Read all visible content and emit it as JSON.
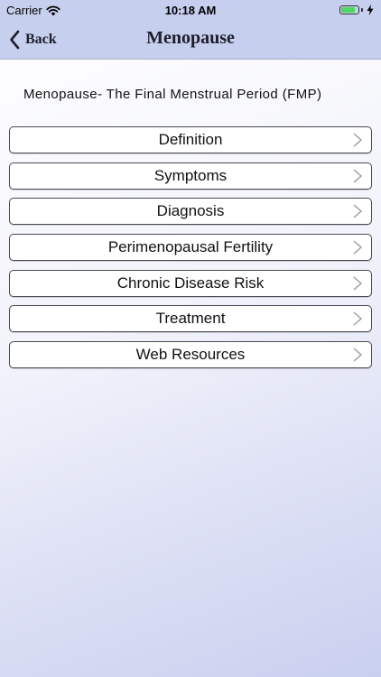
{
  "status_bar": {
    "carrier": "Carrier",
    "time": "10:18 AM",
    "battery_level": 0.85,
    "icons": [
      "wifi-icon",
      "battery-icon",
      "charging-bolt-icon"
    ]
  },
  "nav": {
    "back_label": "Back",
    "title": "Menopause",
    "bar_color": "#c7cfee"
  },
  "subtitle": "Menopause- The Final Menstrual Period (FMP)",
  "menu": {
    "items": [
      {
        "label": "Definition"
      },
      {
        "label": "Symptoms"
      },
      {
        "label": "Diagnosis"
      },
      {
        "label": "Perimenopausal Fertility"
      },
      {
        "label": "Chronic Disease Risk"
      },
      {
        "label": "Treatment"
      },
      {
        "label": "Web Resources"
      }
    ],
    "item_icon": "chevron-right-icon"
  }
}
